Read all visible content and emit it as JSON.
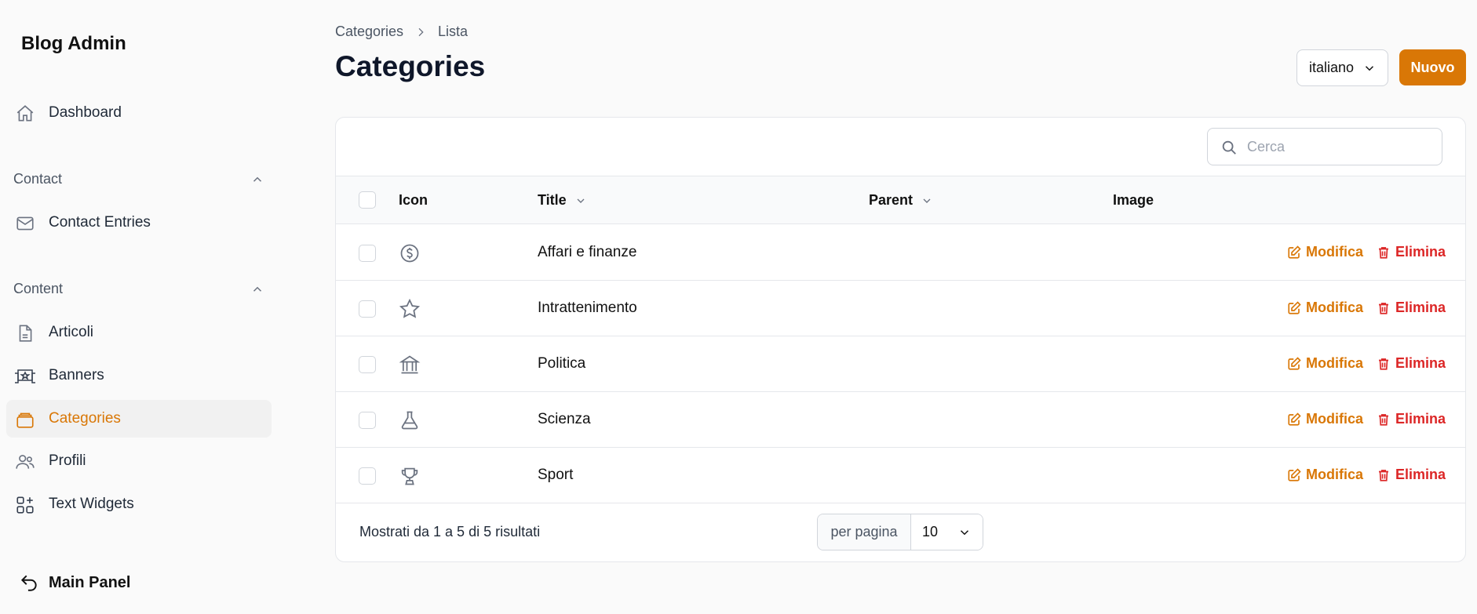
{
  "sidebar": {
    "brand": "Blog Admin",
    "dashboard": "Dashboard",
    "groups": [
      {
        "label": "Contact",
        "items": [
          "Contact Entries"
        ]
      },
      {
        "label": "Content",
        "items": [
          "Articoli",
          "Banners",
          "Categories",
          "Profili",
          "Text Widgets"
        ]
      }
    ],
    "main_panel": "Main Panel"
  },
  "header": {
    "breadcrumb": [
      "Categories",
      "Lista"
    ],
    "title": "Categories",
    "language": "italiano",
    "new_label": "Nuovo"
  },
  "search": {
    "placeholder": "Cerca"
  },
  "table": {
    "columns": [
      "Icon",
      "Title",
      "Parent",
      "Image"
    ],
    "rows": [
      {
        "icon": "currency-dollar-icon",
        "title": "Affari e finanze"
      },
      {
        "icon": "star-icon",
        "title": "Intrattenimento"
      },
      {
        "icon": "building-library-icon",
        "title": "Politica"
      },
      {
        "icon": "beaker-icon",
        "title": "Scienza"
      },
      {
        "icon": "trophy-icon",
        "title": "Sport"
      }
    ],
    "edit_label": "Modifica",
    "delete_label": "Elimina"
  },
  "footer": {
    "summary": "Mostrati da 1 a 5 di 5 risultati",
    "per_page_label": "per pagina",
    "per_page_value": "10"
  },
  "colors": {
    "accent": "#d97706",
    "danger": "#dc2626"
  }
}
